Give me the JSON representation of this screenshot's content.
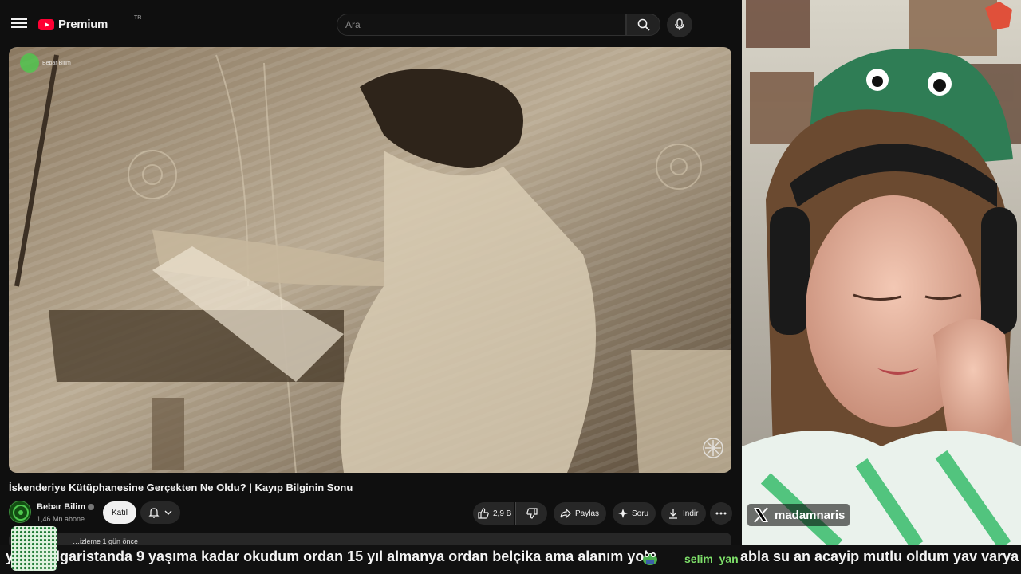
{
  "header": {
    "logo_text": "Premium",
    "logo_country": "TR",
    "search_placeholder": "Ara"
  },
  "video": {
    "watermark_channel": "Bebar Bilim",
    "title": "İskenderiye Kütüphanesine Gerçekten Ne Oldu? | Kayıp Bilginin Sonu"
  },
  "channel": {
    "name": "Bebar Bilim",
    "subscribers": "1,46 Mn abone",
    "join_label": "Katıl"
  },
  "actions": {
    "likes": "2,9 B",
    "share_label": "Paylaş",
    "ask_label": "Soru",
    "download_label": "İndir"
  },
  "description": {
    "meta": "…izleme  1 gün önce"
  },
  "stream": {
    "social_handle": "madamnaris",
    "ticker_message_1": "yani bulgaristanda 9 yaşıma kadar okudum ordan 15 yıl almanya ordan belçika ama alanım yok",
    "ticker_user_2": "selim_yan",
    "ticker_message_2": "abla su an acayip mutlu oldum yav varya"
  },
  "colors": {
    "youtube_red": "#ff0033",
    "background": "#0f0f0f",
    "chat_username": "#7ee06a"
  }
}
